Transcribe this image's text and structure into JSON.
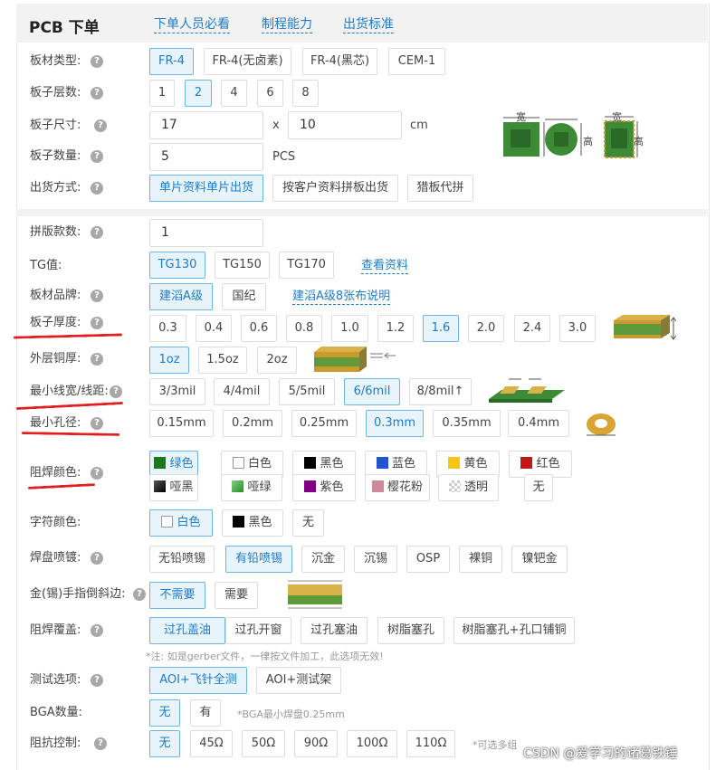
{
  "header": {
    "title": "PCB 下单",
    "links": [
      "下单人员必看",
      "制程能力",
      "出货标准"
    ]
  },
  "help_icon": "?",
  "board_material": {
    "label": "板材类型:",
    "options": [
      "FR-4",
      "FR-4(无卤素)",
      "FR-4(黑芯)",
      "CEM-1"
    ],
    "selected": "FR-4"
  },
  "layers": {
    "label": "板子层数:",
    "options": [
      "1",
      "2",
      "4",
      "6",
      "8"
    ],
    "selected": "2"
  },
  "size": {
    "label": "板子尺寸:",
    "width": "17",
    "separator": "x",
    "height": "10",
    "unit": "cm",
    "diagram_labels": {
      "width": "宽",
      "height": "高"
    }
  },
  "quantity": {
    "label": "板子数量:",
    "value": "5",
    "unit": "PCS"
  },
  "shipping": {
    "label": "出货方式:",
    "options": [
      "单片资料单片出货",
      "按客户资料拼板出货",
      "猎板代拼"
    ],
    "selected": "单片资料单片出货"
  },
  "panel_count": {
    "label": "拼版款数:",
    "value": "1"
  },
  "tg": {
    "label": "TG值:",
    "options": [
      "TG130",
      "TG150",
      "TG170"
    ],
    "selected": "TG130",
    "link": "查看资料"
  },
  "brand": {
    "label": "板材品牌:",
    "options": [
      "建滔A级",
      "国纪"
    ],
    "selected": "建滔A级",
    "link": "建滔A级8张布说明"
  },
  "thickness": {
    "label": "板子厚度:",
    "options": [
      "0.3",
      "0.4",
      "0.6",
      "0.8",
      "1.0",
      "1.2",
      "1.6",
      "2.0",
      "2.4",
      "3.0"
    ],
    "selected": "1.6"
  },
  "copper": {
    "label": "外层铜厚:",
    "options": [
      "1oz",
      "1.5oz",
      "2oz"
    ],
    "selected": "1oz"
  },
  "trace": {
    "label": "最小线宽/线距:",
    "options": [
      "3/3mil",
      "4/4mil",
      "5/5mil",
      "6/6mil",
      "8/8mil↑"
    ],
    "selected": "6/6mil"
  },
  "hole": {
    "label": "最小孔径:",
    "options": [
      "0.15mm",
      "0.2mm",
      "0.25mm",
      "0.3mm",
      "0.35mm",
      "0.4mm"
    ],
    "selected": "0.3mm"
  },
  "mask_color": {
    "label": "阻焊颜色:",
    "options": [
      {
        "name": "绿色",
        "color": "#1a7a1a"
      },
      {
        "name": "白色",
        "color": "#ffffff"
      },
      {
        "name": "黑色",
        "color": "#000000"
      },
      {
        "name": "蓝色",
        "color": "#2255cc"
      },
      {
        "name": "黄色",
        "color": "#f5c518"
      },
      {
        "name": "红色",
        "color": "#c01818"
      },
      {
        "name": "哑黑",
        "color": "#222222"
      },
      {
        "name": "哑绿",
        "color": "#3aa83a"
      },
      {
        "name": "紫色",
        "color": "#800080"
      },
      {
        "name": "樱花粉",
        "color": "#cc8a9a"
      },
      {
        "name": "透明",
        "color": "#dddddd"
      },
      {
        "name": "无",
        "color": ""
      }
    ],
    "selected": "绿色"
  },
  "silk_color": {
    "label": "字符颜色:",
    "options": [
      {
        "name": "白色",
        "color": "#ffffff"
      },
      {
        "name": "黑色",
        "color": "#000000"
      },
      {
        "name": "无",
        "color": ""
      }
    ],
    "selected": "白色"
  },
  "finish": {
    "label": "焊盘喷镀:",
    "options": [
      "无铅喷锡",
      "有铅喷锡",
      "沉金",
      "沉锡",
      "OSP",
      "裸铜",
      "镍钯金"
    ],
    "selected": "有铅喷锡"
  },
  "bevel": {
    "label": "金(锡)手指倒斜边:",
    "options": [
      "不需要",
      "需要"
    ],
    "selected": "不需要"
  },
  "via": {
    "label": "阻焊覆盖:",
    "options": [
      "过孔盖油",
      "过孔开窗",
      "过孔塞油",
      "树脂塞孔",
      "树脂塞孔+孔口铺铜"
    ],
    "selected": "过孔盖油",
    "note": "*注: 如是gerber文件，一律按文件加工，此选项无效!"
  },
  "test": {
    "label": "测试选项:",
    "options": [
      "AOI+飞针全测",
      "AOI+测试架"
    ],
    "selected": "AOI+飞针全测"
  },
  "bga": {
    "label": "BGA数量:",
    "options": [
      "无",
      "有"
    ],
    "selected": "无",
    "note": "*BGA最小焊盘0.25mm"
  },
  "impedance": {
    "label": "阻抗控制:",
    "options": [
      "无",
      "45Ω",
      "50Ω",
      "90Ω",
      "100Ω",
      "110Ω"
    ],
    "selected": "无",
    "note": "*可选多组"
  },
  "watermark": "CSDN @爱学习的诸葛铁锤",
  "colors": {
    "accent": "#1e7bc7",
    "selected_bg": "#e8f4fc",
    "selected_border": "#6fb3e0",
    "annotation": "#e02020",
    "pcb_green": "#3d8b37",
    "pcb_gold": "#c99a2e"
  }
}
